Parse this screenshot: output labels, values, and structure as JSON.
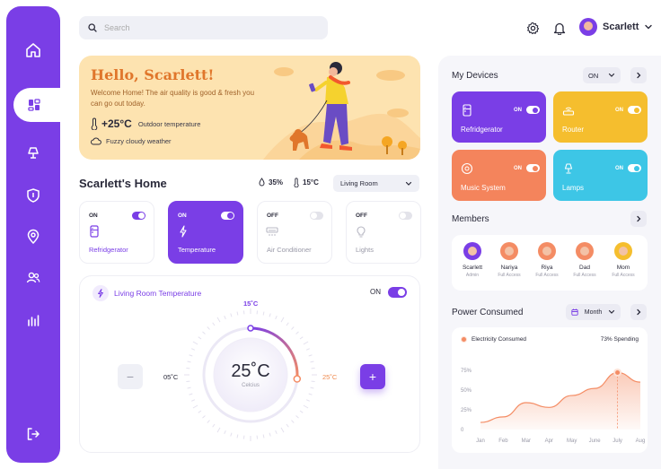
{
  "search": {
    "placeholder": "Search"
  },
  "user": {
    "name": "Scarlett"
  },
  "welcome": {
    "title": "Hello, Scarlett!",
    "message": "Welcome Home! The air quality is good & fresh you can go out today.",
    "temperature": "+25°C",
    "temperature_label": "Outdoor temperature",
    "weather": "Fuzzy cloudy weather"
  },
  "home": {
    "title": "Scarlett's Home",
    "humidity": "35%",
    "temperature": "15°C",
    "room": "Living Room"
  },
  "appliances": [
    {
      "status": "ON",
      "name": "Refridgerator",
      "on": true
    },
    {
      "status": "ON",
      "name": "Temperature",
      "on": true
    },
    {
      "status": "OFF",
      "name": "Air Conditioner",
      "on": false
    },
    {
      "status": "OFF",
      "name": "Lights",
      "on": false
    }
  ],
  "thermostat": {
    "title": "Living Room Temperature",
    "power": "ON",
    "max": "15˚C",
    "min": "05˚C",
    "current_marker": "25˚C",
    "value": "25˚C",
    "unit": "Celcius",
    "minus": "−",
    "plus": "+",
    "fill_fraction": 0.45
  },
  "devices": {
    "title": "My Devices",
    "filter": "ON",
    "items": [
      {
        "name": "Refridgerator",
        "status": "ON",
        "color": "#7a3ee6"
      },
      {
        "name": "Router",
        "status": "ON",
        "color": "#f5be2e"
      },
      {
        "name": "Music System",
        "status": "ON",
        "color": "#f4845c"
      },
      {
        "name": "Lamps",
        "status": "ON",
        "color": "#3dc6e6"
      }
    ]
  },
  "members": {
    "title": "Members",
    "items": [
      {
        "name": "Scarlett",
        "role": "Admin",
        "color": "#7a3ee6"
      },
      {
        "name": "Nariya",
        "role": "Full Access",
        "color": "#f48c64"
      },
      {
        "name": "Riya",
        "role": "Full Access",
        "color": "#f48c64"
      },
      {
        "name": "Dad",
        "role": "Full Access",
        "color": "#f48c64"
      },
      {
        "name": "Mom",
        "role": "Full Access",
        "color": "#f5be2e"
      }
    ]
  },
  "power": {
    "title": "Power Consumed",
    "period": "Month",
    "legend": "Electricity Consumed",
    "spending": "73% Spending"
  },
  "chart_data": {
    "type": "area",
    "categories": [
      "Jan",
      "Feb",
      "Mar",
      "Apr",
      "May",
      "June",
      "July",
      "Aug"
    ],
    "values": [
      9,
      16,
      34,
      28,
      43,
      52,
      72,
      60
    ],
    "y_ticks": [
      "75%",
      "50%",
      "25%",
      "0"
    ],
    "ylim": [
      0,
      85
    ],
    "highlight": "July",
    "color": "#f48c64"
  }
}
